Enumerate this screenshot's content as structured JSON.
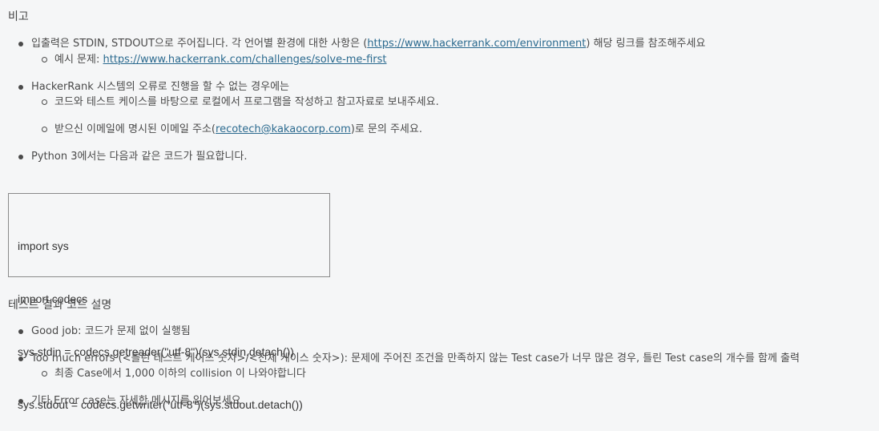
{
  "notes": {
    "heading": "비고",
    "items": [
      {
        "pre": "입출력은 STDIN, STDOUT으로 주어집니다. 각 언어별 환경에 대한 사항은 (",
        "link": "https://www.hackerrank.com/environment",
        "post": ") 해당 링크를 참조해주세요",
        "sub": {
          "pre": "예시 문제: ",
          "link": "https://www.hackerrank.com/challenges/solve-me-first"
        }
      },
      {
        "text": "HackerRank 시스템의 오류로 진행을 할 수 없는 경우에는",
        "subs": [
          {
            "text": "코드와 테스트 케이스를 바탕으로 로컬에서 프로그램을 작성하고 참고자료로 보내주세요."
          },
          {
            "pre": "받으신 이메일에 명시된 이메일 주소(",
            "link": "recotech@kakaocorp.com",
            "post": ")로 문의 주세요."
          }
        ]
      },
      {
        "text": "Python 3에서는 다음과 같은 코드가 필요합니다."
      }
    ]
  },
  "code": {
    "lines": [
      "import sys",
      "import codecs",
      "sys.stdin = codecs.getreader(\"utf-8\")(sys.stdin.detach())",
      "sys.stdout = codecs.getwriter(\"utf-8\")(sys.stdout.detach())"
    ]
  },
  "results": {
    "heading": "테스트 결과 코드 설명",
    "items": [
      {
        "text": "Good job: 코드가 문제 없이 실행됨"
      },
      {
        "text": "Too much errors (<틀린 테스트 케이스 숫자>/<전체 케이스 숫자>): 문제에 주어진 조건을 만족하지 않는 Test case가 너무 많은 경우, 틀린 Test case의 개수를 함께 출력",
        "sub": "최종 Case에서 1,000 이하의 collision 이 나와야합니다"
      },
      {
        "text": "기타 Error case는 자세한 메시지를 읽어보세요"
      }
    ]
  },
  "colors": {
    "background": "#f5f6f7",
    "text": "#4a4a4a",
    "link": "#2b6a8f",
    "code_border": "#8a8a8a"
  }
}
